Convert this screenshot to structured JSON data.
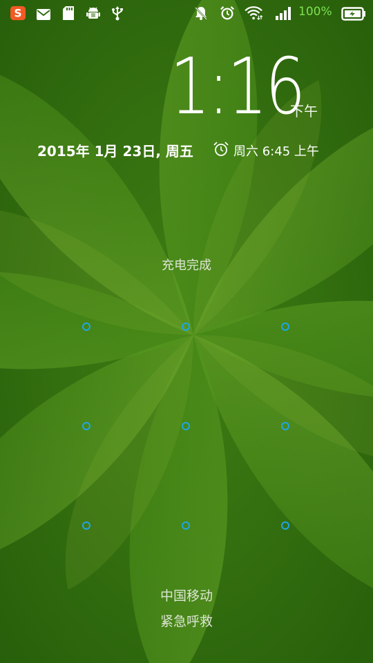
{
  "status_bar": {
    "battery_percent": "100%",
    "icons": [
      "sogou-input-icon",
      "mail-icon",
      "sd-card-icon",
      "android-debug-icon",
      "usb-icon",
      "mute-bell-icon",
      "alarm-clock-icon",
      "wifi-icon",
      "signal-icon",
      "battery-charging-icon"
    ],
    "battery_text_color": "#7ee051"
  },
  "lockscreen": {
    "time": "1:16",
    "ampm": "下午",
    "date": "2015年 1月 23日, 周五",
    "next_alarm": "周六 6:45 上午",
    "charge_status": "充电完成",
    "carrier": "中国移动",
    "emergency_call": "紧急呼救"
  },
  "pattern": {
    "dot_color": "#1ea7e6"
  },
  "colors": {
    "wallpaper_base": "#2f6e0f",
    "petal": "#5b9a1e"
  }
}
